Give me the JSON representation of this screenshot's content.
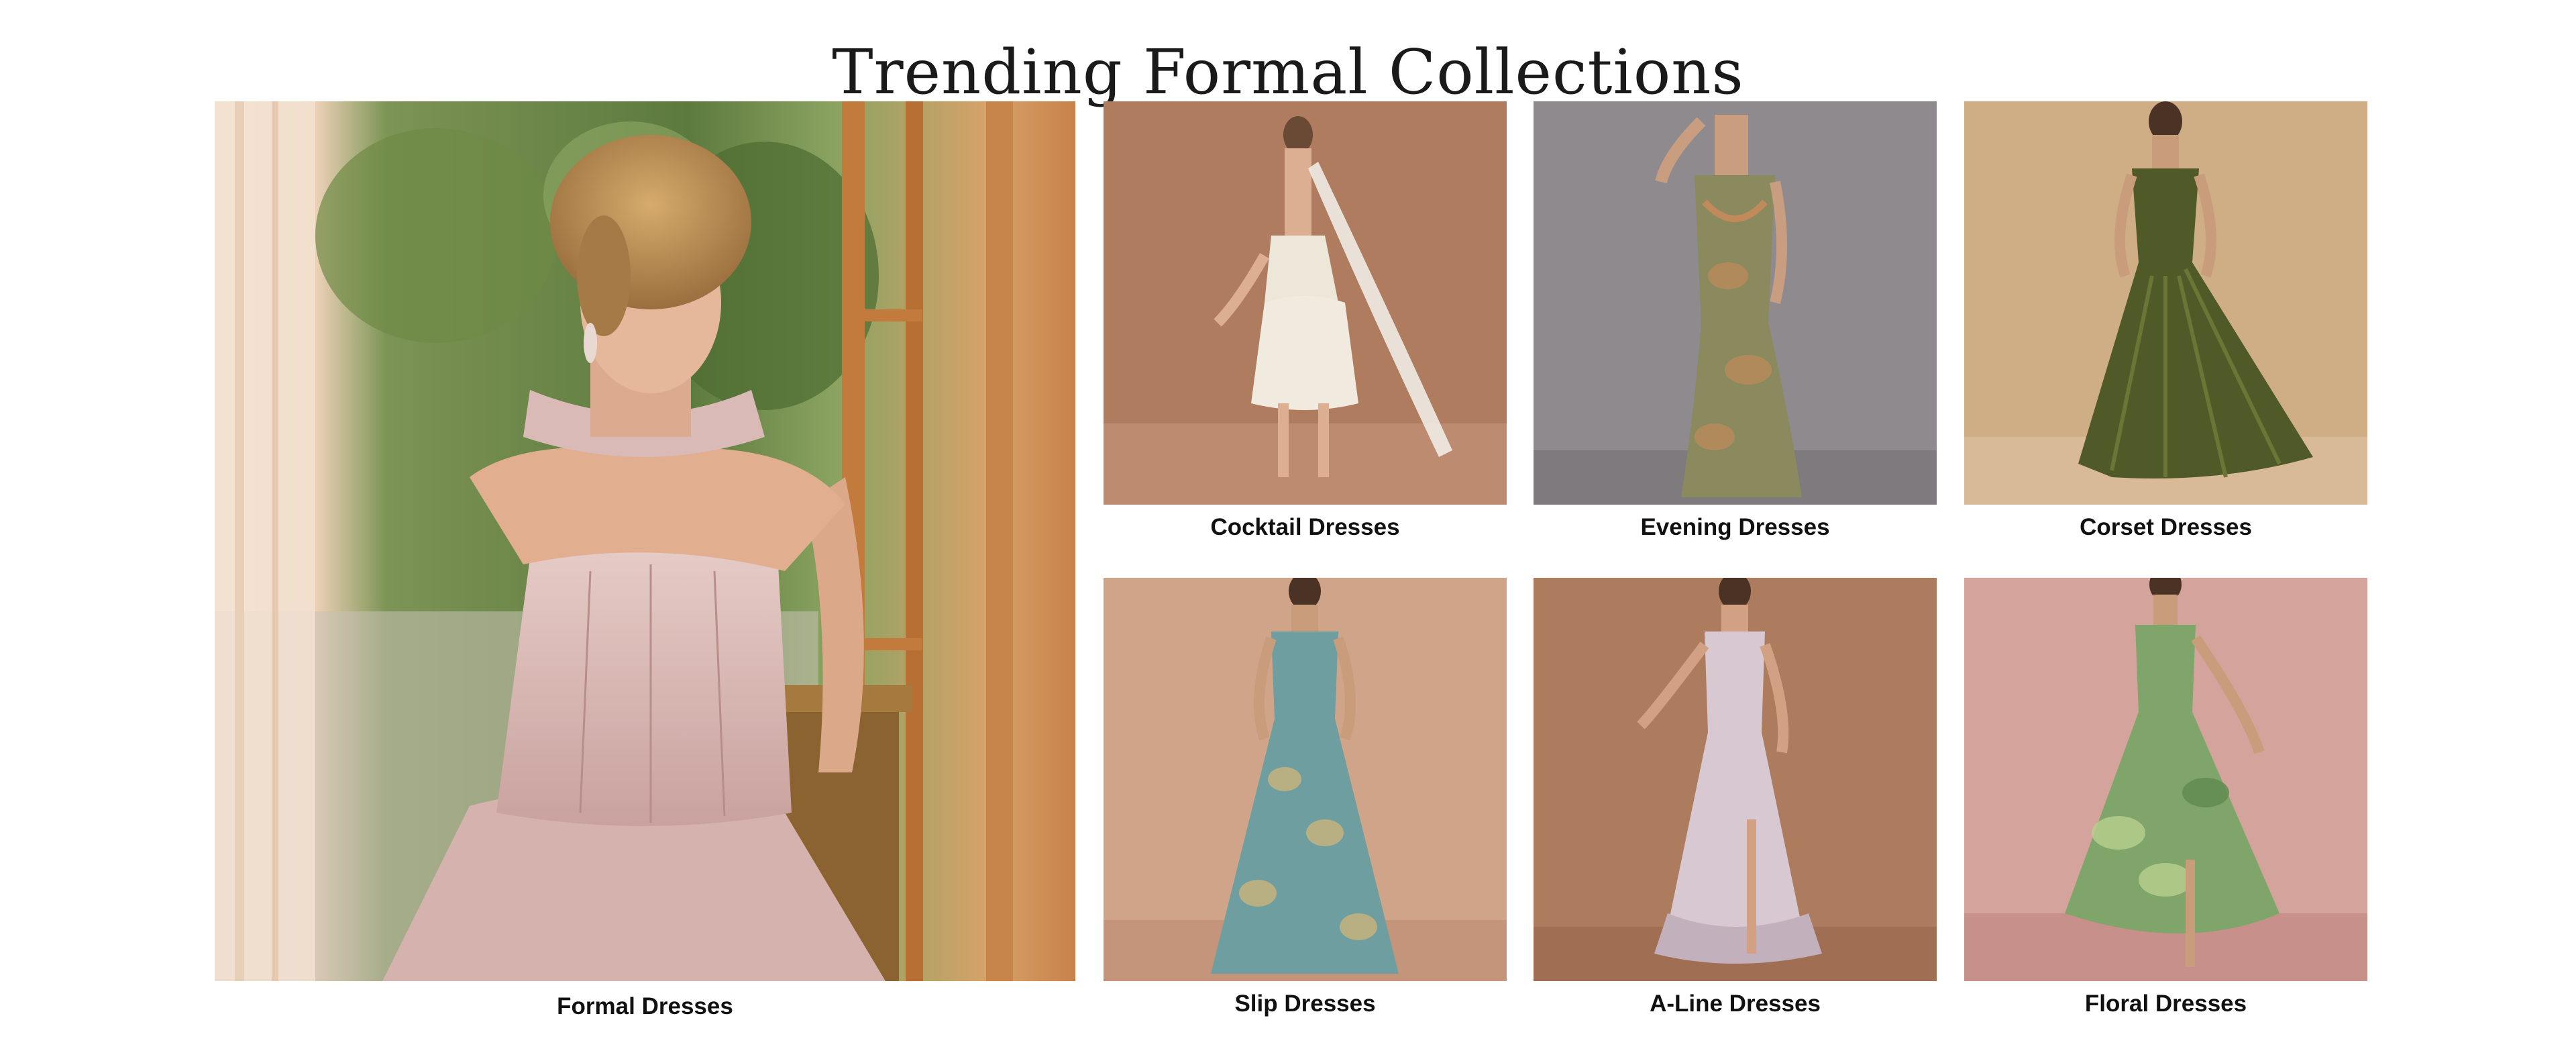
{
  "page": {
    "title": "Trending Formal Collections"
  },
  "feature": {
    "label": "Formal Dresses",
    "image_alt": "Model in pink strapless corset ball gown with neck scarf by a sunlit window",
    "colors": {
      "background": "#6f8a4c",
      "dress": "#d9b8b4",
      "skin": "#e2b294",
      "hair": "#b8894f",
      "frame": "#c88a4a"
    }
  },
  "collections": [
    {
      "label": "Cocktail Dresses",
      "image_alt": "White jacquard strapless midi dress with neck scarf",
      "colors": {
        "background": "#b07c60",
        "dress": "#ede7da",
        "accent": "#f4efe6"
      }
    },
    {
      "label": "Evening Dresses",
      "image_alt": "Green and copper brocade mermaid maxi dress",
      "colors": {
        "background": "#8f8a8e",
        "dress": "#8a8a5e",
        "accent": "#c08a5a"
      }
    },
    {
      "label": "Corset Dresses",
      "image_alt": "Olive green pleated satin corset maxi dress",
      "colors": {
        "background": "#cfae86",
        "dress": "#4f5a28",
        "accent": "#6b7636"
      }
    },
    {
      "label": "Slip Dresses",
      "image_alt": "Teal and gold jacquard maxi slip dress",
      "colors": {
        "background": "#cfa489",
        "dress": "#6e9ea0",
        "accent": "#cbb47a"
      }
    },
    {
      "label": "A-Line Dresses",
      "image_alt": "Lilac satin A-line maxi dress with side slit",
      "colors": {
        "background": "#ad7b5d",
        "dress": "#d8c8d2",
        "accent": "#c2b0bd"
      }
    },
    {
      "label": "Floral Dresses",
      "image_alt": "Green floral chiffon maxi dress with front slit",
      "colors": {
        "background": "#d4a39c",
        "dress": "#7fa56a",
        "accent": "#b9cf8f"
      }
    }
  ]
}
